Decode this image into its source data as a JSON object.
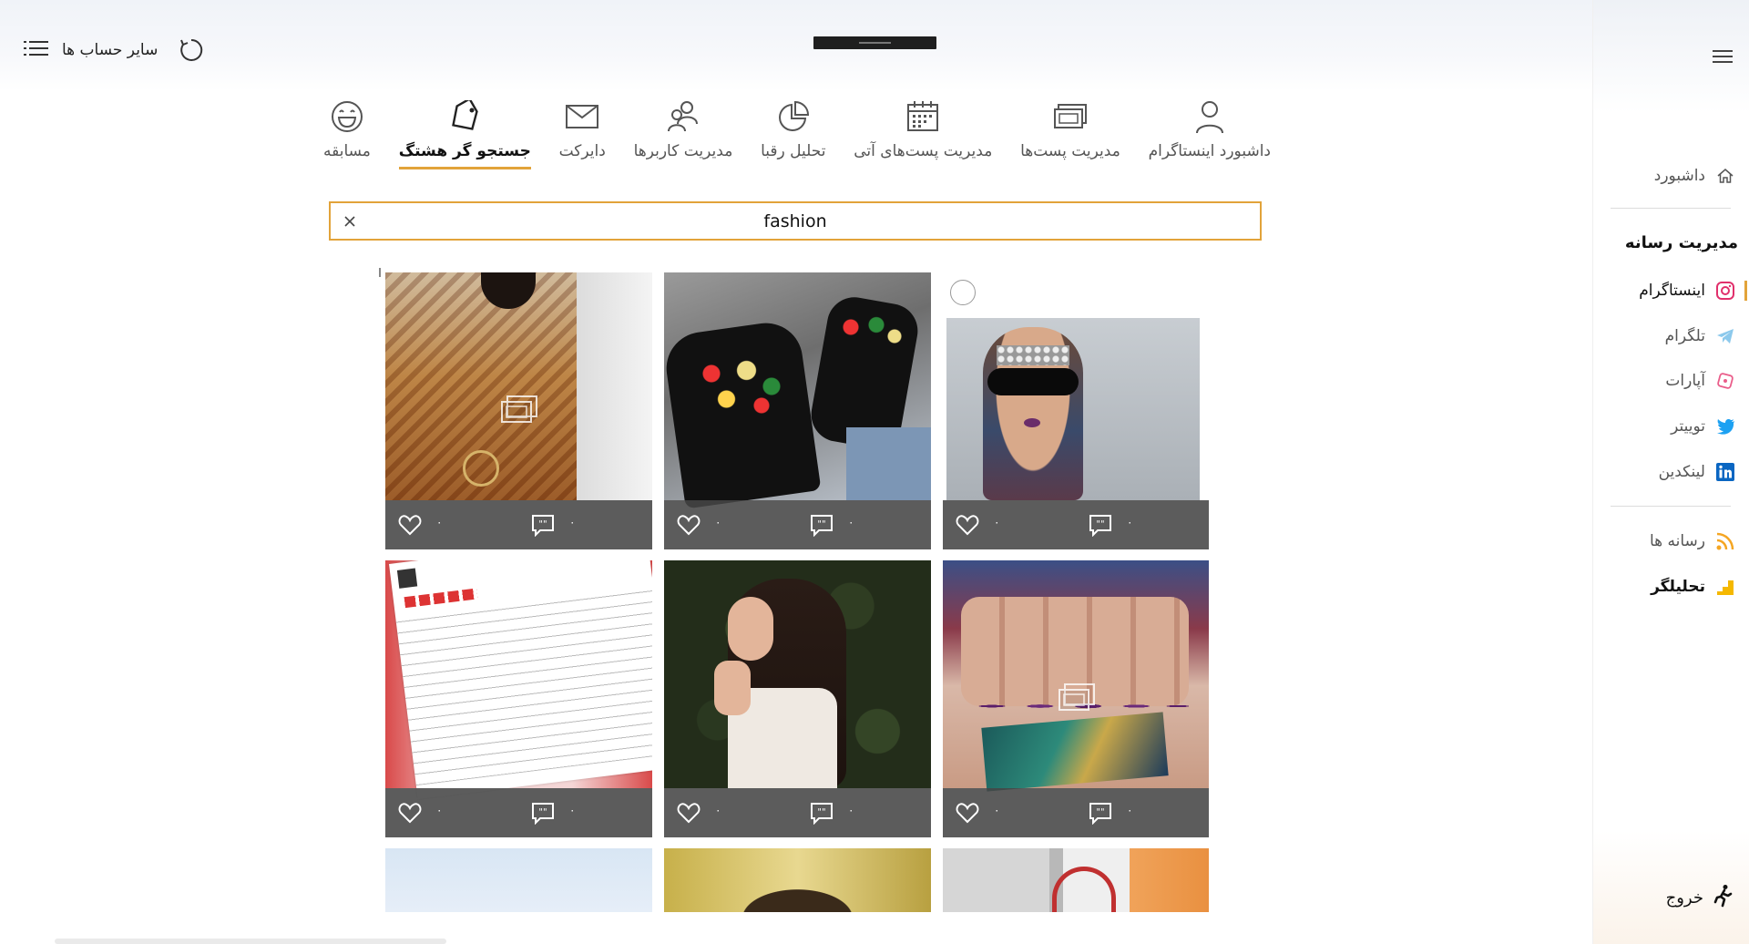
{
  "header": {
    "accounts_label": "سایر حساب ها"
  },
  "sidebar": {
    "dashboard": "داشبورد",
    "heading": "مدیریت رسانه",
    "items": [
      {
        "label": "اینستاگرام",
        "icon": "instagram-icon",
        "color": "#e1306c"
      },
      {
        "label": "تلگرام",
        "icon": "telegram-icon",
        "color": "#2ca5e0"
      },
      {
        "label": "آپارات",
        "icon": "aparat-icon",
        "color": "#ea1d5d"
      },
      {
        "label": "توییتر",
        "icon": "twitter-icon",
        "color": "#1da1f2"
      },
      {
        "label": "لینکدین",
        "icon": "linkedin-icon",
        "color": "#0077b5"
      }
    ],
    "media": "رسانه ها",
    "analyzer": "تحلیلگر",
    "logout": "خروج"
  },
  "tabs": [
    {
      "label": "داشبورد اینستاگرام",
      "icon": "user-icon"
    },
    {
      "label": "مدیریت پست‌ها",
      "icon": "posts-icon"
    },
    {
      "label": "مدیریت پست‌های آتی",
      "icon": "calendar-icon"
    },
    {
      "label": "تحلیل رقبا",
      "icon": "pie-chart-icon"
    },
    {
      "label": "مدیریت کاربرها",
      "icon": "users-icon"
    },
    {
      "label": "دایرکت",
      "icon": "mail-icon"
    },
    {
      "label": "جستجو گر هشتگ",
      "icon": "tag-icon",
      "active": true
    },
    {
      "label": "مسابقه",
      "icon": "smile-icon"
    }
  ],
  "search": {
    "value": "fashion"
  },
  "posts": [
    {
      "likes": "۰",
      "comments": "۰",
      "album": true
    },
    {
      "likes": "۰",
      "comments": "۰",
      "album": false
    },
    {
      "likes": "۰",
      "comments": "۰",
      "album": false
    },
    {
      "likes": "۰",
      "comments": "۰",
      "album": false
    },
    {
      "likes": "۰",
      "comments": "۰",
      "album": false
    },
    {
      "likes": "۰",
      "comments": "۰",
      "album": true
    }
  ],
  "accent_color": "#e2a33a"
}
